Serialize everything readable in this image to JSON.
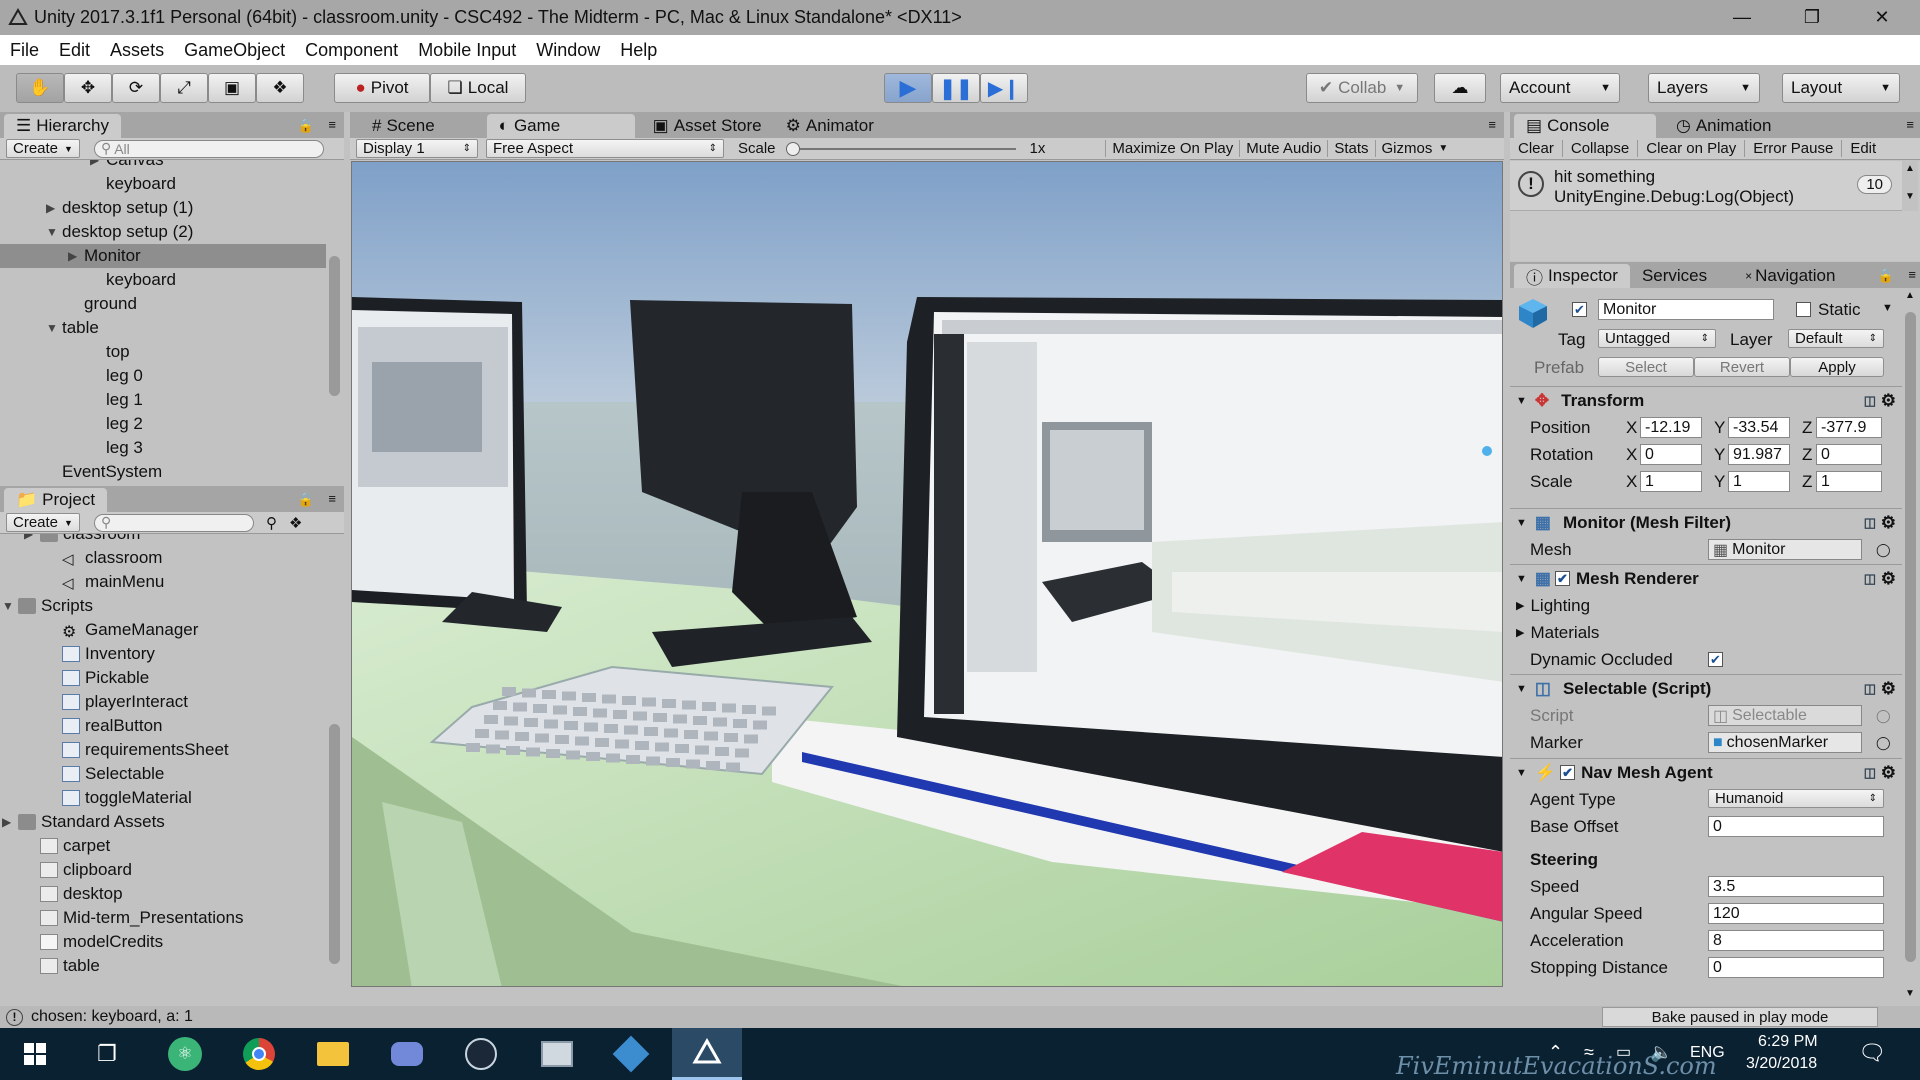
{
  "window": {
    "title": "Unity 2017.3.1f1 Personal (64bit) - classroom.unity - CSC492 - The Midterm - PC, Mac & Linux Standalone* <DX11>"
  },
  "menu": [
    "File",
    "Edit",
    "Assets",
    "GameObject",
    "Component",
    "Mobile Input",
    "Window",
    "Help"
  ],
  "toolbar": {
    "pivot": "Pivot",
    "local": "Local",
    "collab": "Collab",
    "account": "Account",
    "layers": "Layers",
    "layout": "Layout"
  },
  "hierarchy": {
    "tab": "Hierarchy",
    "create": "Create",
    "search_placeholder": "All",
    "items": [
      {
        "label": "Canvas",
        "indent": 4,
        "arrow": "right"
      },
      {
        "label": "keyboard",
        "indent": 4,
        "arrow": ""
      },
      {
        "label": "desktop setup (1)",
        "indent": 2,
        "arrow": "right"
      },
      {
        "label": "desktop setup (2)",
        "indent": 2,
        "arrow": "down"
      },
      {
        "label": "Monitor",
        "indent": 3,
        "arrow": "right",
        "selected": true
      },
      {
        "label": "keyboard",
        "indent": 4,
        "arrow": ""
      },
      {
        "label": "ground",
        "indent": 3,
        "arrow": ""
      },
      {
        "label": "table",
        "indent": 2,
        "arrow": "down"
      },
      {
        "label": "top",
        "indent": 4,
        "arrow": ""
      },
      {
        "label": "leg 0",
        "indent": 4,
        "arrow": ""
      },
      {
        "label": "leg 1",
        "indent": 4,
        "arrow": ""
      },
      {
        "label": "leg 2",
        "indent": 4,
        "arrow": ""
      },
      {
        "label": "leg 3",
        "indent": 4,
        "arrow": ""
      },
      {
        "label": "EventSystem",
        "indent": 2,
        "arrow": ""
      }
    ]
  },
  "project": {
    "tab": "Project",
    "create": "Create",
    "items": [
      {
        "label": "classroom",
        "indent": 1,
        "arrow": "right",
        "icon": "folder"
      },
      {
        "label": "classroom",
        "indent": 2,
        "arrow": "",
        "icon": "unity"
      },
      {
        "label": "mainMenu",
        "indent": 2,
        "arrow": "",
        "icon": "unity"
      },
      {
        "label": "Scripts",
        "indent": 0,
        "arrow": "down",
        "icon": "folder"
      },
      {
        "label": "GameManager",
        "indent": 2,
        "arrow": "",
        "icon": "gear"
      },
      {
        "label": "Inventory",
        "indent": 2,
        "arrow": "",
        "icon": "cs"
      },
      {
        "label": "Pickable",
        "indent": 2,
        "arrow": "",
        "icon": "cs"
      },
      {
        "label": "playerInteract",
        "indent": 2,
        "arrow": "",
        "icon": "cs"
      },
      {
        "label": "realButton",
        "indent": 2,
        "arrow": "",
        "icon": "cs"
      },
      {
        "label": "requirementsSheet",
        "indent": 2,
        "arrow": "",
        "icon": "cs"
      },
      {
        "label": "Selectable",
        "indent": 2,
        "arrow": "",
        "icon": "cs"
      },
      {
        "label": "toggleMaterial",
        "indent": 2,
        "arrow": "",
        "icon": "cs"
      },
      {
        "label": "Standard Assets",
        "indent": 0,
        "arrow": "right",
        "icon": "folder"
      },
      {
        "label": "carpet",
        "indent": 1,
        "arrow": "",
        "icon": "image"
      },
      {
        "label": "clipboard",
        "indent": 1,
        "arrow": "",
        "icon": "image"
      },
      {
        "label": "desktop",
        "indent": 1,
        "arrow": "",
        "icon": "image"
      },
      {
        "label": "Mid-term_Presentations",
        "indent": 1,
        "arrow": "",
        "icon": "image"
      },
      {
        "label": "modelCredits",
        "indent": 1,
        "arrow": "",
        "icon": "text"
      },
      {
        "label": "table",
        "indent": 1,
        "arrow": "",
        "icon": "image"
      }
    ]
  },
  "center_tabs": [
    {
      "label": "Scene",
      "icon": "#"
    },
    {
      "label": "Game",
      "icon": "◐",
      "active": true
    },
    {
      "label": "Asset Store",
      "icon": "▣"
    },
    {
      "label": "Animator",
      "icon": "⚙"
    }
  ],
  "game_bar": {
    "display": "Display 1",
    "aspect": "Free Aspect",
    "scale_label": "Scale",
    "scale_value": "1x",
    "scale_fraction": 0.0,
    "maximize": "Maximize On Play",
    "mute": "Mute Audio",
    "stats": "Stats",
    "gizmos": "Gizmos"
  },
  "console": {
    "tab": "Console",
    "tab2": "Animation",
    "buttons": [
      "Clear",
      "Collapse",
      "Clear on Play",
      "Error Pause",
      "Edit"
    ],
    "message_line1": "hit something",
    "message_line2": "UnityEngine.Debug:Log(Object)",
    "count": "10"
  },
  "inspector": {
    "tabs": [
      "Inspector",
      "Services",
      "Navigation"
    ],
    "object_name": "Monitor",
    "static_label": "Static",
    "tag_label": "Tag",
    "tag_value": "Untagged",
    "layer_label": "Layer",
    "layer_value": "Default",
    "prefab_label": "Prefab",
    "prefab_select": "Select",
    "prefab_revert": "Revert",
    "prefab_apply": "Apply",
    "transform": {
      "title": "Transform",
      "position_label": "Position",
      "position": [
        "-12.19",
        "-33.54",
        "-377.9"
      ],
      "rotation_label": "Rotation",
      "rotation": [
        "0",
        "91.987",
        "0"
      ],
      "scale_label": "Scale",
      "scale": [
        "1",
        "1",
        "1"
      ]
    },
    "mesh_filter": {
      "title": "Monitor (Mesh Filter)",
      "mesh_label": "Mesh",
      "mesh_value": "Monitor"
    },
    "mesh_renderer": {
      "title": "Mesh Renderer",
      "lighting": "Lighting",
      "materials": "Materials",
      "dynamic_occluded": "Dynamic Occluded"
    },
    "selectable": {
      "title": "Selectable (Script)",
      "script_label": "Script",
      "script_value": "Selectable",
      "marker_label": "Marker",
      "marker_value": "chosenMarker"
    },
    "nav_agent": {
      "title": "Nav Mesh Agent",
      "agent_type_label": "Agent Type",
      "agent_type_value": "Humanoid",
      "base_offset_label": "Base Offset",
      "base_offset": "0",
      "steering": "Steering",
      "speed_label": "Speed",
      "speed": "3.5",
      "angular_label": "Angular Speed",
      "angular": "120",
      "accel_label": "Acceleration",
      "accel": "8",
      "stopping_label": "Stopping Distance",
      "stopping": "0"
    }
  },
  "status": {
    "message": "chosen: keyboard, a: 1",
    "bake": "Bake paused in play mode"
  },
  "taskbar": {
    "lang": "ENG",
    "time": "6:29 PM",
    "date": "3/20/2018",
    "watermark": "FivEminutEvacationS.com"
  },
  "colors": {
    "play_blue": "#2b6fd6",
    "taskbar": "#0a2131"
  }
}
